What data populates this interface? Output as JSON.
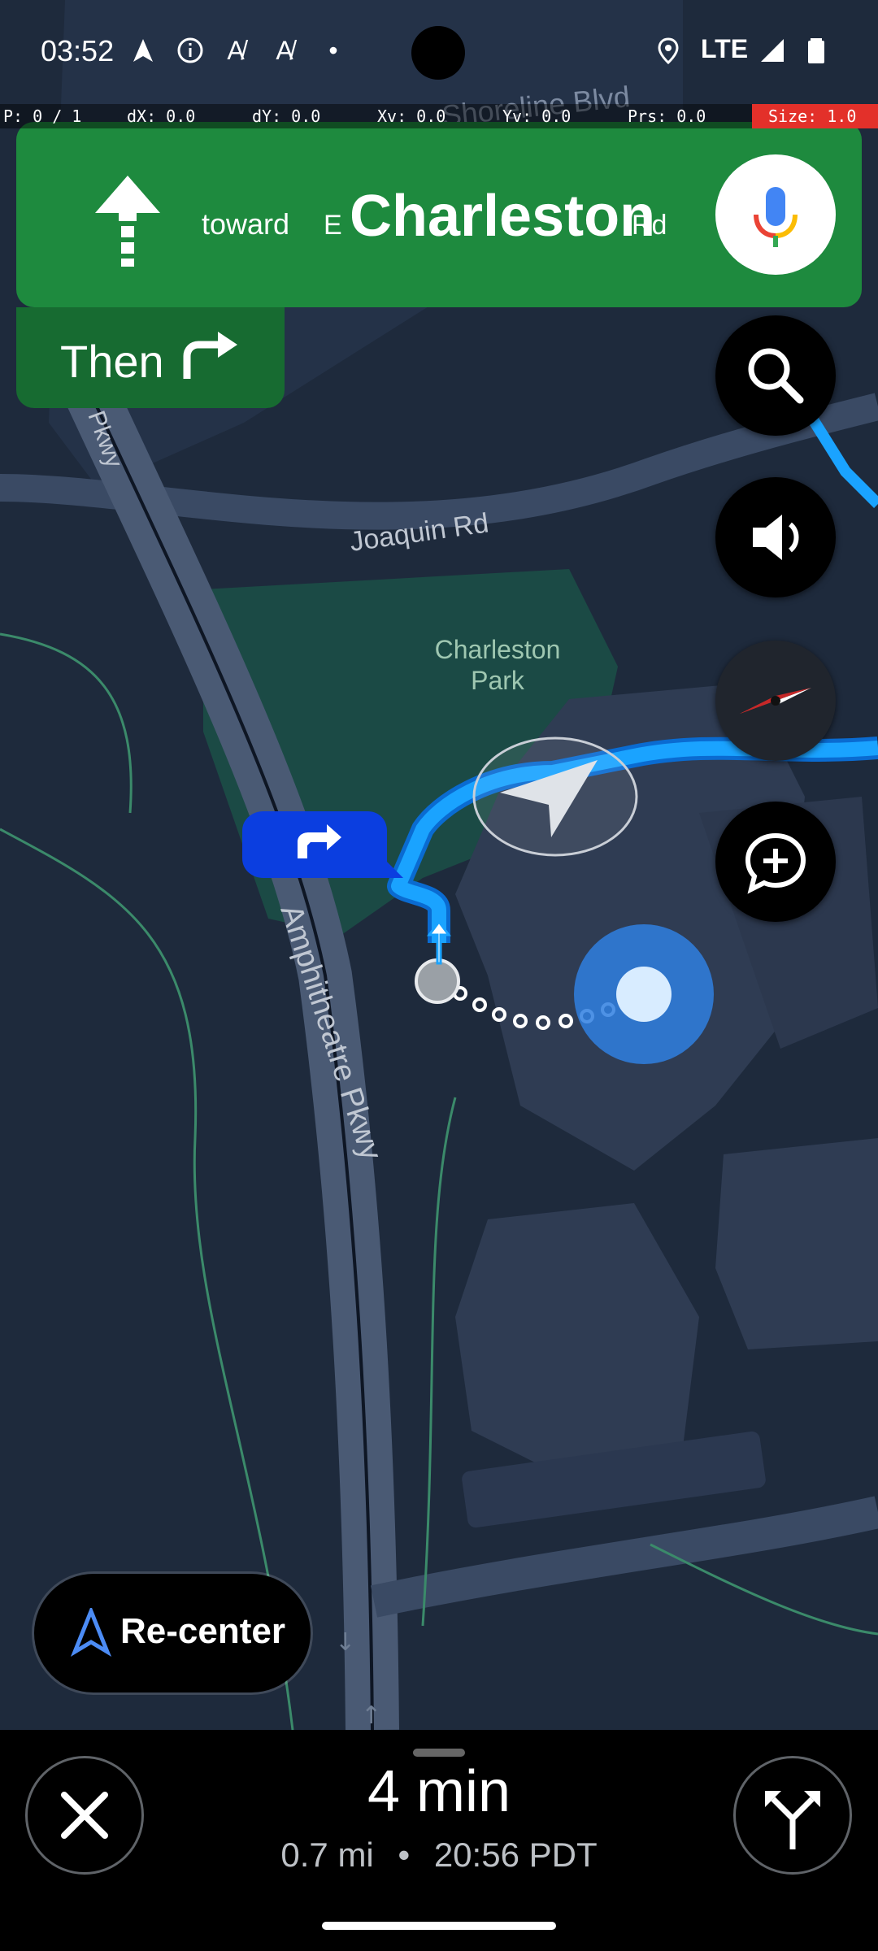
{
  "status_bar": {
    "time": "03:52",
    "network": "LTE",
    "icons": [
      "navigation-arrow-icon",
      "info-icon",
      "auto-icon",
      "auto-icon",
      "dot-icon",
      "location-icon",
      "signal-icon",
      "battery-icon"
    ]
  },
  "debug_bar": {
    "pointer": "P: 0 / 1",
    "dx": "dX: 0.0",
    "dy": "dY: 0.0",
    "xv": "Xv: 0.0",
    "yv": "Yv: 0.0",
    "prs": "Prs: 0.0",
    "size": "Size: 1.0"
  },
  "navigation": {
    "toward": "toward",
    "street_prefix": "E",
    "street_name": "Charleston",
    "street_suffix": "Rd",
    "then_label": "Then",
    "header_color": "#1e8a3e",
    "then_color": "#176b31"
  },
  "map": {
    "labels": {
      "top_road": "Shoreline Blvd",
      "joaquin": "Joaquin Rd",
      "park_line1": "Charleston",
      "park_line2": "Park",
      "amphitheatre": "Amphitheatre Pkwy",
      "left_road": "Pkwy"
    },
    "route_color": "#1aa3ff",
    "turn_marker_color": "#0b3ee0"
  },
  "controls": {
    "recenter_label": "Re-center"
  },
  "trip": {
    "eta_duration": "4 min",
    "distance": "0.7 mi",
    "arrival": "20:56 PDT",
    "separator": "•"
  }
}
